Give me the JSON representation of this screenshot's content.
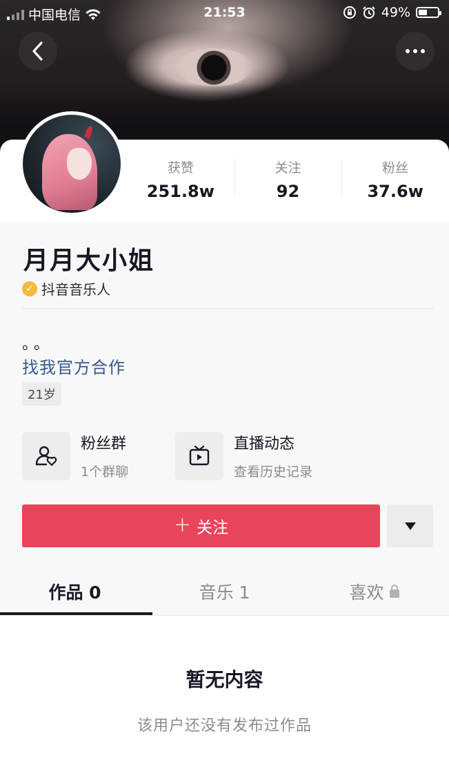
{
  "status_bar": {
    "carrier": "中国电信",
    "time": "21:53",
    "battery": "49%"
  },
  "header": {
    "back_icon": "chevron-left-icon",
    "more_icon": "more-dots-icon"
  },
  "profile": {
    "name": "月月大小姐",
    "verify_label": "抖音音乐人",
    "bio": "。。",
    "link": "找我官方合作",
    "age_tag": "21岁"
  },
  "stats": [
    {
      "label": "获赞",
      "value": "251.8w"
    },
    {
      "label": "关注",
      "value": "92"
    },
    {
      "label": "粉丝",
      "value": "37.6w"
    }
  ],
  "entries": {
    "fans_group": {
      "title": "粉丝群",
      "sub": "1个群聊",
      "icon": "user-heart-icon"
    },
    "live": {
      "title": "直播动态",
      "sub": "查看历史记录",
      "icon": "tv-play-icon"
    }
  },
  "actions": {
    "follow_label": "关注",
    "follow_prefix": "+",
    "dropdown_icon": "triangle-down-icon"
  },
  "tabs": [
    {
      "label": "作品 0"
    },
    {
      "label": "音乐 1"
    },
    {
      "label": "喜欢"
    }
  ],
  "empty_state": {
    "title": "暂无内容",
    "subtitle": "该用户还没有发布过作品"
  },
  "colors": {
    "follow_button": "#e9455a",
    "link": "#36598c",
    "verify_badge": "#f5b93b"
  }
}
